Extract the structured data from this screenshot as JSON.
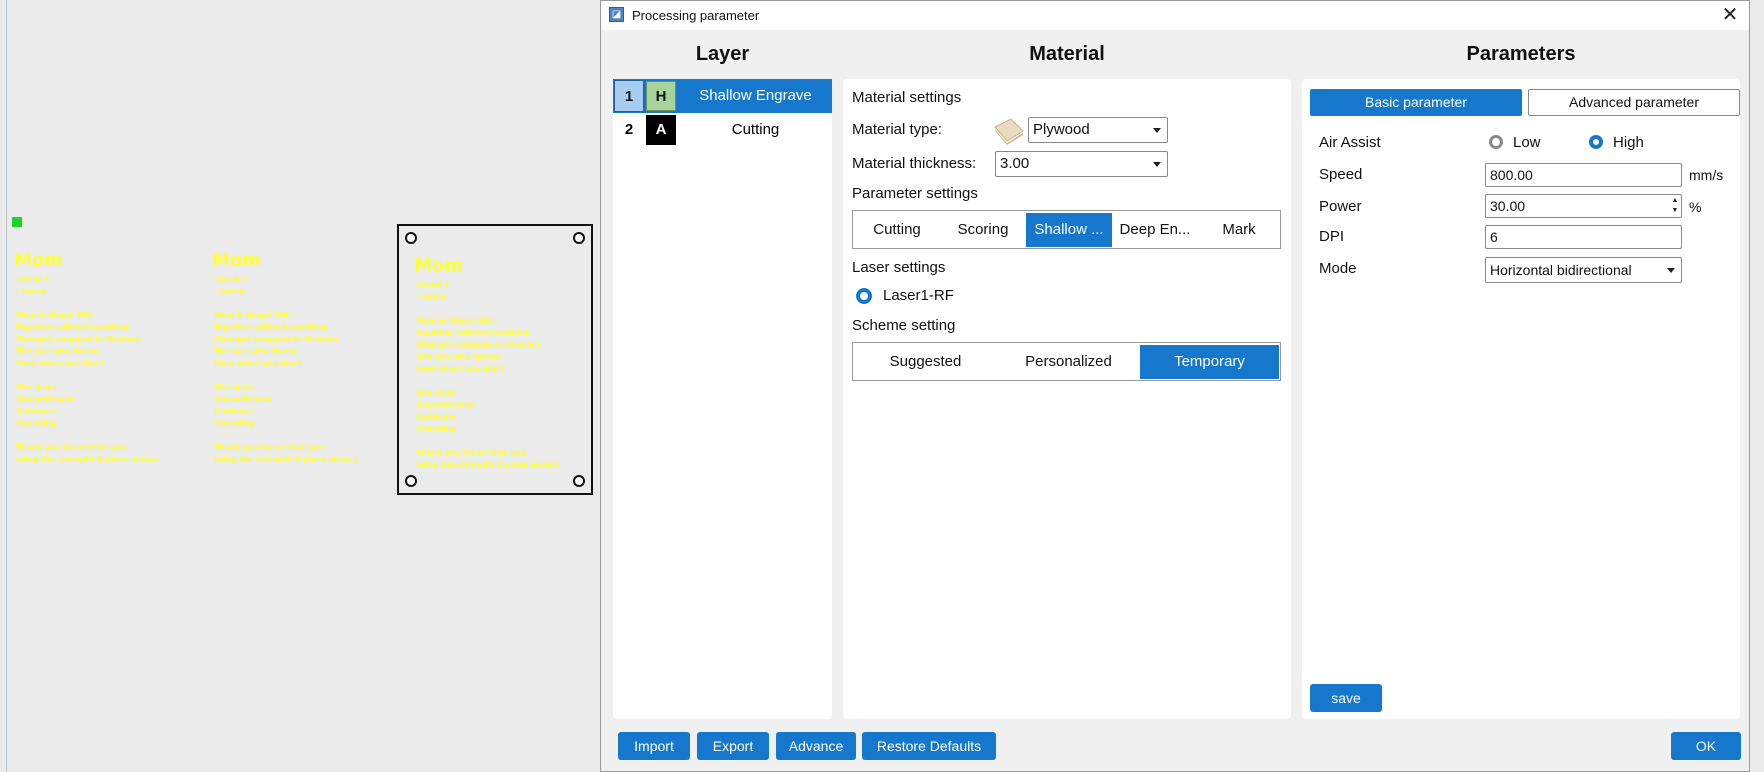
{
  "canvas": {
    "designs": [
      {
        "title": "Mom",
        "lines": [
          "Lorem I",
          "- lorem",
          "",
          "Mom is Magic Still.",
          "Together without condition",
          "Strength wrapped in Wisdom",
          "The one who listens",
          "Even when you don't",
          "",
          "She loves",
          "Unconditional",
          "Guidance",
          "Unending",
          "",
          "Thank you for all that you",
          "bring the strength it gives       always"
        ]
      },
      {
        "title": "Mom",
        "lines": [
          "Lorem I",
          "- lorem",
          "",
          "Mom is Magic Still.",
          "Together without condition",
          "Strength wrapped in Wisdom",
          "The one who listens",
          "Even when you don't",
          "",
          "She loves",
          "Unconditional",
          "Guidance",
          "Unending",
          "",
          "Thank you for all that you",
          "bring the strength it gives       always"
        ]
      },
      {
        "title": "Mom",
        "lines": [
          "Lorem I",
          "- lorem",
          "",
          "Mom is Magic Still.",
          "Together without condition",
          "Strength wrapped in Wisdom",
          "The one who listens",
          "Even when you don't",
          "",
          "She loves",
          "Unconditional",
          "Guidance",
          "Unending",
          "",
          "Thank you for all that you",
          "bring the strength it gives       always"
        ]
      }
    ]
  },
  "dialog": {
    "title": "Processing parameter",
    "headers": {
      "layer": "Layer",
      "material": "Material",
      "parameters": "Parameters"
    }
  },
  "layers": [
    {
      "num": "1",
      "mode": "H",
      "name": "Shallow Engrave",
      "selected": true
    },
    {
      "num": "2",
      "mode": "A",
      "name": "Cutting",
      "selected": false
    }
  ],
  "material": {
    "settings_title": "Material settings",
    "type_label": "Material type:",
    "type_value": "Plywood",
    "thickness_label": "Material thickness:",
    "thickness_value": "3.00",
    "param_settings_title": "Parameter settings",
    "param_tabs": [
      {
        "label": "Cutting",
        "selected": false
      },
      {
        "label": "Scoring",
        "selected": false
      },
      {
        "label": "Shallow ...",
        "selected": true
      },
      {
        "label": "Deep En...",
        "selected": false
      },
      {
        "label": "Mark",
        "selected": false
      }
    ],
    "laser_title": "Laser settings",
    "laser_option": "Laser1-RF",
    "scheme_title": "Scheme setting",
    "scheme_tabs": [
      {
        "label": "Suggested",
        "selected": false
      },
      {
        "label": "Personalized",
        "selected": false
      },
      {
        "label": "Temporary",
        "selected": true
      }
    ]
  },
  "parameters": {
    "tab_basic": "Basic parameter",
    "tab_advanced": "Advanced parameter",
    "air_assist_label": "Air Assist",
    "air_low": "Low",
    "air_high": "High",
    "air_selected": "High",
    "speed_label": "Speed",
    "speed_value": "800.00",
    "speed_unit": "mm/s",
    "power_label": "Power",
    "power_value": "30.00",
    "power_unit": "%",
    "dpi_label": "DPI",
    "dpi_value": "6",
    "mode_label": "Mode",
    "mode_value": "Horizontal bidirectional",
    "save_label": "save"
  },
  "footer": {
    "import": "Import",
    "export": "Export",
    "advance": "Advance",
    "restore": "Restore Defaults",
    "ok": "OK"
  },
  "colors": {
    "accent": "#1678cc",
    "engrave_text": "#ffff3a",
    "mode_h": "#a7d39b"
  }
}
